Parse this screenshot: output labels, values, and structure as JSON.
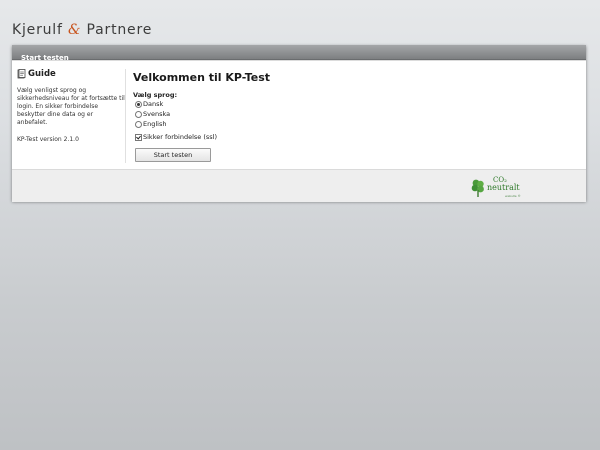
{
  "brand": {
    "name_part1": "Kjerulf",
    "amp": "&",
    "name_part2": "Partnere"
  },
  "panel": {
    "header_title": "Start testen"
  },
  "guide": {
    "title": "Guide",
    "icon": "guide-book-icon",
    "text": "Vælg venligst sprog og sikkerhedsniveau for at fortsætte til login. En sikker forbindelse beskytter dine data og er anbefalet.",
    "version": "KP-Test version 2.1.0"
  },
  "main": {
    "title": "Velkommen til KP-Test",
    "language_label": "Vælg sprog:",
    "languages": [
      {
        "label": "Dansk",
        "checked": true
      },
      {
        "label": "Svenska",
        "checked": false
      },
      {
        "label": "English",
        "checked": false
      }
    ],
    "secure_label": "Sikker forbindelse (ssl)",
    "secure_checked": true,
    "start_button": "Start testen"
  },
  "footer": {
    "badge_icon": "co2-neutral-leaf-icon",
    "badge_top": "CO₂",
    "badge_main": "neutralt",
    "badge_sub": "website ®"
  },
  "colors": {
    "accent_amp": "#c8541e",
    "badge_green": "#2f7a2a",
    "header_bar": "#7d7f81"
  }
}
